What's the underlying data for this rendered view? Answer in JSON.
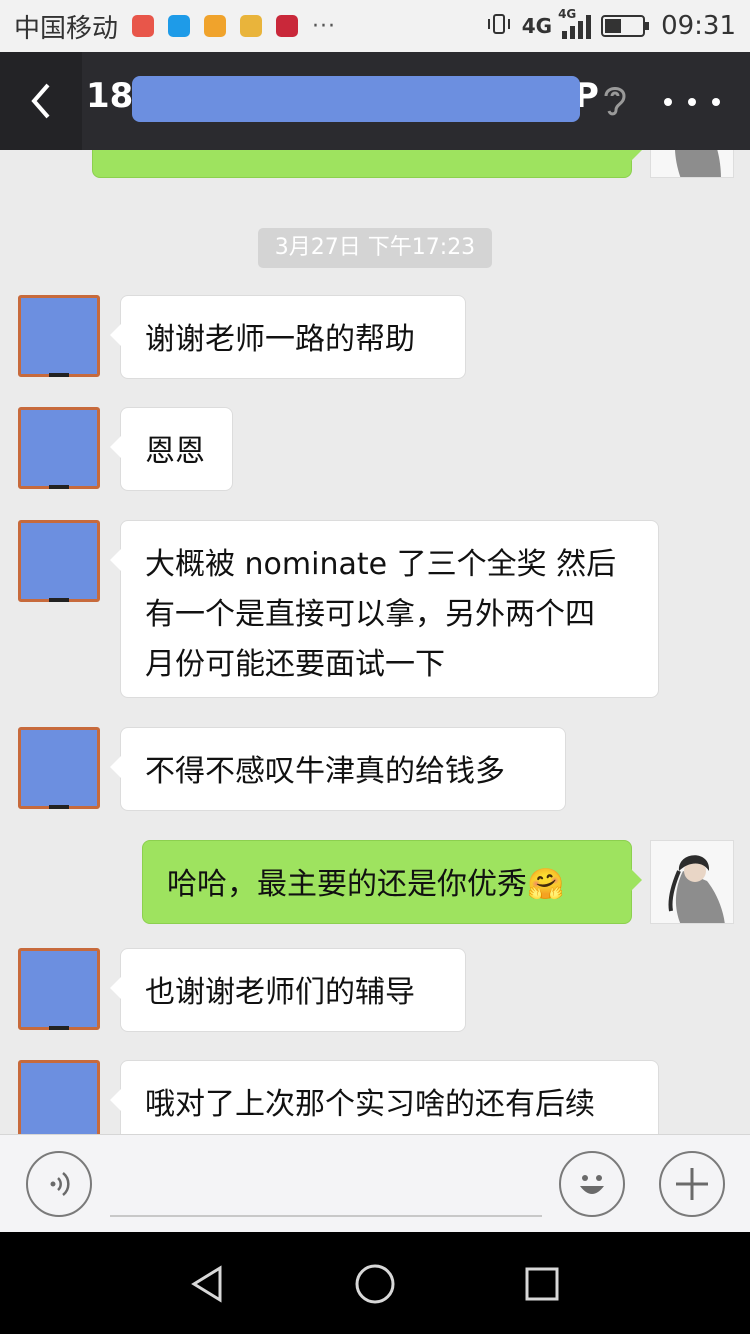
{
  "status_bar": {
    "carrier": "中国移动",
    "network": "4G",
    "network_secondary": "4G",
    "battery_level": 0.4,
    "time": "09:31",
    "notification_icons": [
      "missed-call-icon",
      "message-icon",
      "shopping-bag-icon",
      "wifi-app-icon",
      "huawei-icon"
    ],
    "overflow_dots": "···"
  },
  "header": {
    "title_prefix": "18s",
    "title_suffix_visible": "P",
    "back_icon": "chevron-left-icon",
    "ear_icon": "ear-icon",
    "more_icon": "more-dots-icon"
  },
  "colors": {
    "title_bar": "#2b2b2f",
    "outgoing_bubble": "#9ee35f",
    "incoming_bubble": "#ffffff",
    "background": "#ebebeb",
    "redaction": "#6c8fe0"
  },
  "timestamp": "3月27日 下午17:23",
  "messages": [
    {
      "sender": "contact",
      "text": "谢谢老师一路的帮助"
    },
    {
      "sender": "contact",
      "text": "恩恩"
    },
    {
      "sender": "contact",
      "lines": [
        "大概被 nominate 了三个全奖 然后",
        "有一个是直接可以拿，另外两个四",
        "月份可能还要面试一下"
      ]
    },
    {
      "sender": "contact",
      "text": "不得不感叹牛津真的给钱多"
    },
    {
      "sender": "me",
      "text": "哈哈，最主要的还是你优秀",
      "emoji": "🤗"
    },
    {
      "sender": "contact",
      "text": "也谢谢老师们的辅导"
    },
    {
      "sender": "contact",
      "text": "哦对了上次那个实习啥的还有后续"
    }
  ],
  "input_bar": {
    "voice_icon": "voice-icon",
    "emoji_icon": "emoji-icon",
    "plus_icon": "plus-icon"
  },
  "nav_bar": {
    "back_icon": "triangle-back-icon",
    "home_icon": "circle-home-icon",
    "recents_icon": "square-recents-icon"
  }
}
